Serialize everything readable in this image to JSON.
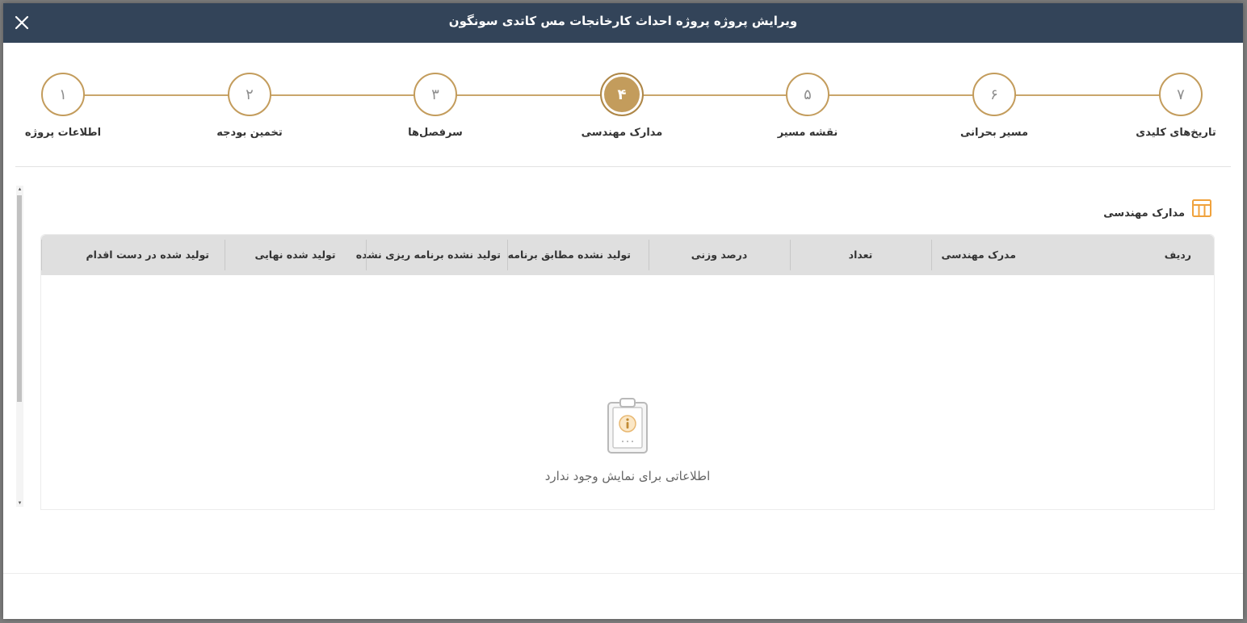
{
  "modal": {
    "title": "ویرایش پروژه پروژه احداث کارخانجات مس کاتدی سونگون",
    "close_icon": "close-icon"
  },
  "colors": {
    "header_bg": "#334459",
    "step_accent": "#c39c5c",
    "section_icon": "#f0a23c"
  },
  "stepper": {
    "active_step": 4,
    "steps": [
      {
        "number": "۱",
        "label": "اطلاعات پروژه"
      },
      {
        "number": "۲",
        "label": "تخمین بودجه"
      },
      {
        "number": "۳",
        "label": "سرفصل‌ها"
      },
      {
        "number": "۴",
        "label": "مدارک مهندسی"
      },
      {
        "number": "۵",
        "label": "نقشه مسیر"
      },
      {
        "number": "۶",
        "label": "مسیر بحرانی"
      },
      {
        "number": "۷",
        "label": "تاریخ‌های کلیدی"
      }
    ]
  },
  "section": {
    "title": "مدارک مهندسی",
    "icon": "table-icon"
  },
  "table": {
    "columns": [
      "ردیف",
      "مدرک مهندسی",
      "تعداد",
      "درصد وزنی",
      "تولید نشده مطابق برنامه",
      "تولید نشده برنامه ریزی نشده",
      "تولید شده نهایی",
      "تولید شده در دست اقدام"
    ],
    "rows": [],
    "empty_message": "اطلاعاتی برای نمایش وجود ندارد",
    "empty_icon": "clipboard-info-icon"
  }
}
